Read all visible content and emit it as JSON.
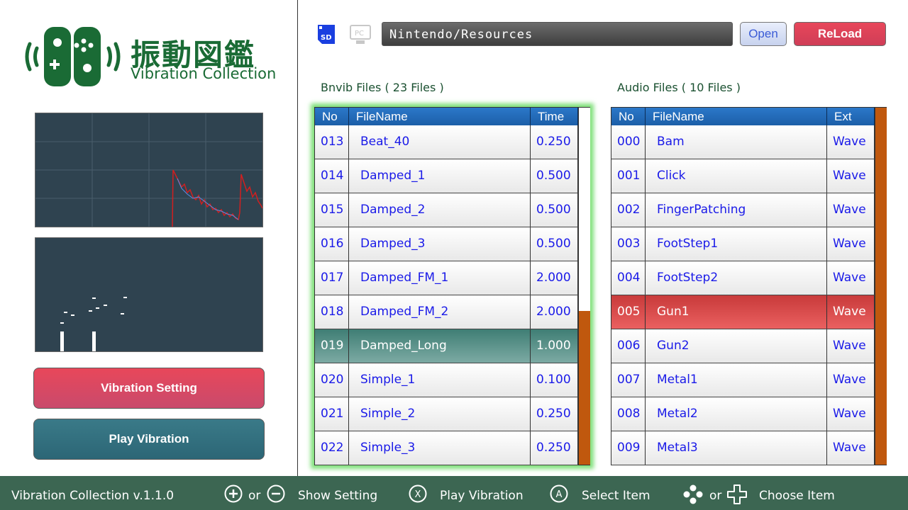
{
  "logo": {
    "title": "振動図鑑",
    "subtitle": "Vibration Collection",
    "brand_color": "#1a6b35"
  },
  "graphs": {
    "background": "#2f4350"
  },
  "buttons": {
    "vibration_setting": "Vibration Setting",
    "play_vibration": "Play Vibration"
  },
  "topbar": {
    "sd_icon_label": "SD",
    "pc_icon_label": "PC",
    "path": "Nintendo/Resources",
    "open_label": "Open",
    "reload_label": "ReLoad"
  },
  "bnvib": {
    "label": "Bnvib Files ( 23 Files )",
    "columns": [
      "No",
      "FileName",
      "Time"
    ],
    "selected_index": 6,
    "scroll_position": 0.57,
    "rows": [
      {
        "no": "013",
        "name": "Beat_40",
        "val": "0.250"
      },
      {
        "no": "014",
        "name": "Damped_1",
        "val": "0.500"
      },
      {
        "no": "015",
        "name": "Damped_2",
        "val": "0.500"
      },
      {
        "no": "016",
        "name": "Damped_3",
        "val": "0.500"
      },
      {
        "no": "017",
        "name": "Damped_FM_1",
        "val": "2.000"
      },
      {
        "no": "018",
        "name": "Damped_FM_2",
        "val": "2.000"
      },
      {
        "no": "019",
        "name": "Damped_Long",
        "val": "1.000"
      },
      {
        "no": "020",
        "name": "Simple_1",
        "val": "0.100"
      },
      {
        "no": "021",
        "name": "Simple_2",
        "val": "0.250"
      },
      {
        "no": "022",
        "name": "Simple_3",
        "val": "0.250"
      }
    ]
  },
  "audio": {
    "label": "Audio Files ( 10 Files )",
    "columns": [
      "No",
      "FileName",
      "Ext"
    ],
    "selected_index": 5,
    "rows": [
      {
        "no": "000",
        "name": "Bam",
        "val": "Wave"
      },
      {
        "no": "001",
        "name": "Click",
        "val": "Wave"
      },
      {
        "no": "002",
        "name": "FingerPatching",
        "val": "Wave"
      },
      {
        "no": "003",
        "name": "FootStep1",
        "val": "Wave"
      },
      {
        "no": "004",
        "name": "FootStep2",
        "val": "Wave"
      },
      {
        "no": "005",
        "name": "Gun1",
        "val": "Wave"
      },
      {
        "no": "006",
        "name": "Gun2",
        "val": "Wave"
      },
      {
        "no": "007",
        "name": "Metal1",
        "val": "Wave"
      },
      {
        "no": "008",
        "name": "Metal2",
        "val": "Wave"
      },
      {
        "no": "009",
        "name": "Metal3",
        "val": "Wave"
      }
    ]
  },
  "footer": {
    "version": "Vibration Collection v.1.1.0",
    "or1": "or",
    "show_setting": "Show Setting",
    "x_glyph": "X",
    "play_vibration": "Play Vibration",
    "a_glyph": "A",
    "select_item": "Select Item",
    "or2": "or",
    "choose_item": "Choose Item"
  },
  "colors": {
    "header_blue": "#1c5fa8",
    "accent_red": "#e8475a",
    "accent_teal": "#2c6676",
    "scroll_orange": "#c0580e",
    "selection_glow": "#7fe07a",
    "footer_bg": "#3c6652",
    "link_text": "#1a1ae8"
  }
}
